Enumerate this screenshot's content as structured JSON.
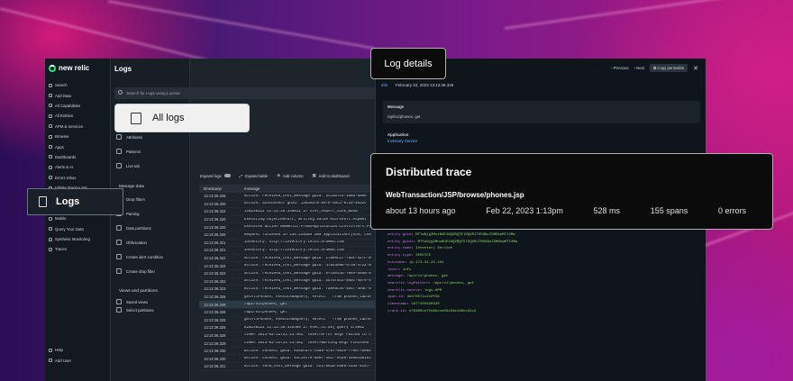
{
  "nav": {
    "brand": "new relic",
    "items": [
      "Search",
      "Add Data",
      "All Capabilities",
      "All Entities",
      "APM & Services",
      "Browser",
      "Apps",
      "Dashboards",
      "Alerts & AI",
      "Errors Inbox",
      "Infinite Tracing Set",
      "Infrastructure",
      "Logs",
      "Mobile",
      "Query Your Data",
      "Synthetic Monitoring",
      "Traces"
    ],
    "bottom": [
      "Help",
      "Add User"
    ]
  },
  "logs": {
    "title": "Logs",
    "search_placeholder": "Search for Logs using Lucene",
    "sub_items": [
      "Attributes",
      "Patterns",
      "Live tail"
    ],
    "manage_heading": "Manage data",
    "manage_items": [
      "Drop filters",
      "Parsing",
      "Data partitions",
      "Obfuscation",
      "Create alert condition",
      "Create drop filter"
    ],
    "views_heading": "Views and partitions",
    "views_items": [
      "Saved views",
      "Select partitions"
    ]
  },
  "toolbar": {
    "expand_logs": "Expand logs",
    "expand_table": "Expand table",
    "add_column": "Add column",
    "add_dashboard": "Add to dashboard"
  },
  "table": {
    "col_timestamp": "timestamp",
    "col_message": "message",
    "rows": [
      {
        "ts": "13:13:36.328",
        "msg": "action: received_text_message guid: 3c23b7c4-1d8b-4a0e"
      },
      {
        "ts": "13:13:36.320",
        "msg": "action: disconnect guid: 13634876-5e7e-48c2-8f10-4032c"
      },
      {
        "ts": "13:13:36.322",
        "msg": "I2N230222 21:13:36.338811   27 otel_export_sink_mana"
      },
      {
        "ts": "13:13:36.320",
        "msg": "Executing ObjectResult, writing value Microsoft.AspNet"
      },
      {
        "ts": "13:13:36.320",
        "msg": "Executed action NewRelic.PromoApplication.Controllers.Pr"
      },
      {
        "ts": "13:13:36.320",
        "msg": "Request finished in 235.2282ms 200 application/json; cha"
      },
      {
        "ts": "13:13:36.321",
        "msg": "inventory: http://inventory.telco.nrdemo.com"
      },
      {
        "ts": "13:13:36.321",
        "msg": "inventory: http://inventory.telco.nrdemo.com"
      },
      {
        "ts": "13:13:36.322",
        "msg": "action: received_text_message guid: 17ae6c27-f5dc-427c-8"
      },
      {
        "ts": "13:13:36.322",
        "msg": "action: received_text_message guid: 4f844e88-5fd8-4722-8"
      },
      {
        "ts": "13:13:36.322",
        "msg": "action: received_text_message guid: efcde24d-7084-495a-a"
      },
      {
        "ts": "13:13:36.322",
        "msg": "action: received_text_message guid: 5df8f5cb-058c-4079-9"
      },
      {
        "ts": "13:13:36.323",
        "msg": "action: received_text_message guid: fa0e5c44-5b4f-4ebc-9"
      },
      {
        "ts": "13:13:36.326",
        "msg": "getAllPhones, executeDBQuery, select * from phones_table"
      },
      {
        "ts": "13:13:36.326",
        "msg": "/api/v1/phones, get"
      },
      {
        "ts": "13:13:36.326",
        "msg": "/api/v1/phones, get"
      },
      {
        "ts": "13:13:36.328",
        "msg": "getAllPhones, executeDBQuery, select * from phones_table"
      },
      {
        "ts": "13:13:36.329",
        "msg": "E2N230222 21:13:36.329309    27 exec.cc:59] Query 1f5862"
      },
      {
        "ts": "13:13:36.329",
        "msg": "time=\"2023-02-22T21:13:36Z\" level=error msg=\"Failed to c"
      },
      {
        "ts": "13:13:36.329",
        "msg": "time=\"2023-02-22T21:13:36Z\" level=warning msg=\"Finished"
      },
      {
        "ts": "13:13:36.330",
        "msg": "action: connect guid: 035bcdfc-c0a9-4f87-9a1e-7f5e770065"
      },
      {
        "ts": "13:13:36.330",
        "msg": "action: connect guid: 83c1ecf0-ae0f-4b2f-9ca0-3390150181"
      },
      {
        "ts": "13:13:36.331",
        "msg": "action: send_text_message guid: e21f862b-bd88-4144-9157-"
      }
    ]
  },
  "detail": {
    "buttons": [
      "Previous",
      "Next",
      "Copy permalink"
    ],
    "level": "info",
    "date": "February 22, 2023 13:13:36.326",
    "message_label": "Message",
    "message_value": "/api/v1/phones, get",
    "application_label": "Application",
    "application_value": "Inventory Service",
    "attributes": [
      {
        "k": "entity.guid",
        "v": "MTYwNjg3MnxBUE18QVBQTElDQVRJT058NzI5MDkwMTI4Mw"
      },
      {
        "k": "entity.guids",
        "v": "MTYwNjg3MnxBUE18QVBQTElDQVRJT058NzI5MDkwMTI4Mw"
      },
      {
        "k": "entity.name",
        "v": "Inventory Service"
      },
      {
        "k": "entity.type",
        "v": "SERVICE"
      },
      {
        "k": "hostname",
        "v": "ip-173-31-24-191"
      },
      {
        "k": "level",
        "v": "info"
      },
      {
        "k": "message",
        "v": "/api/v1/phones, get"
      },
      {
        "k": "newrelic.logPattern",
        "v": "/api/v1/phones, get"
      },
      {
        "k": "newrelic.source",
        "v": "logs.APM"
      },
      {
        "k": "span.id",
        "v": "4eb73571c2c0f58"
      },
      {
        "k": "timestamp",
        "v": "1677100436326"
      },
      {
        "k": "trace.id",
        "v": "e76300ce7fe8bcce0943de1d6cc91c2"
      }
    ]
  },
  "callouts": {
    "logs": "Logs",
    "all_logs": "All logs",
    "log_details": "Log details",
    "trace_title": "Distributed trace",
    "trace_name": "WebTransaction/JSP/browse/phones.jsp",
    "trace_stats": [
      "about 13 hours ago",
      "Feb 22, 2023 1:13pm",
      "528 ms",
      "155 spans",
      "0 errors"
    ]
  },
  "colors": {
    "accent": "#1ce783",
    "chart_bar": "#c8366c",
    "link": "#6fb3ff"
  }
}
